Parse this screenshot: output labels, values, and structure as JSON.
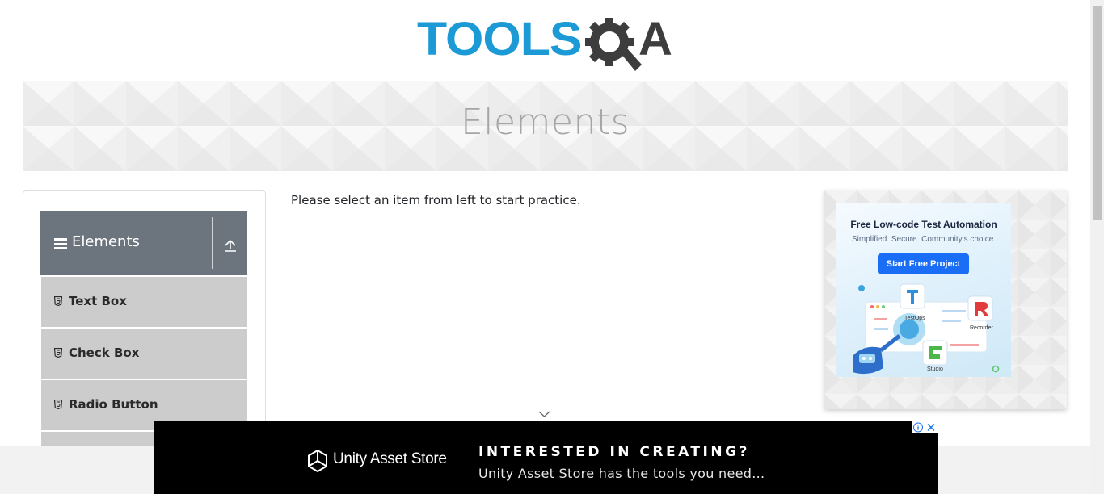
{
  "header": {
    "logo_text_tools": "TOOLS",
    "logo_text_a": "A",
    "banner_title": "Elements"
  },
  "sidebar": {
    "group_label": "Elements",
    "items": [
      {
        "label": "Text Box",
        "icon": "html5-icon"
      },
      {
        "label": "Check Box",
        "icon": "html5-icon"
      },
      {
        "label": "Radio Button",
        "icon": "html5-icon"
      }
    ]
  },
  "main": {
    "instruction": "Please select an item from left to start practice."
  },
  "side_ad": {
    "title": "Free Low-code Test Automation",
    "subtitle": "Simplified. Secure. Community's choice.",
    "button_label": "Start Free Project",
    "labels": [
      "TestOps",
      "Recorder",
      "Studio"
    ]
  },
  "bottom_ad": {
    "brand": "Unity Asset Store",
    "headline": "INTERESTED IN CREATING?",
    "subline": "Unity Asset Store has the tools you need..."
  },
  "colors": {
    "brand_blue": "#1b9ad6",
    "brand_dark": "#3d3d3d",
    "group_header": "#6c757d",
    "menu_item_bg": "#cccccc"
  }
}
